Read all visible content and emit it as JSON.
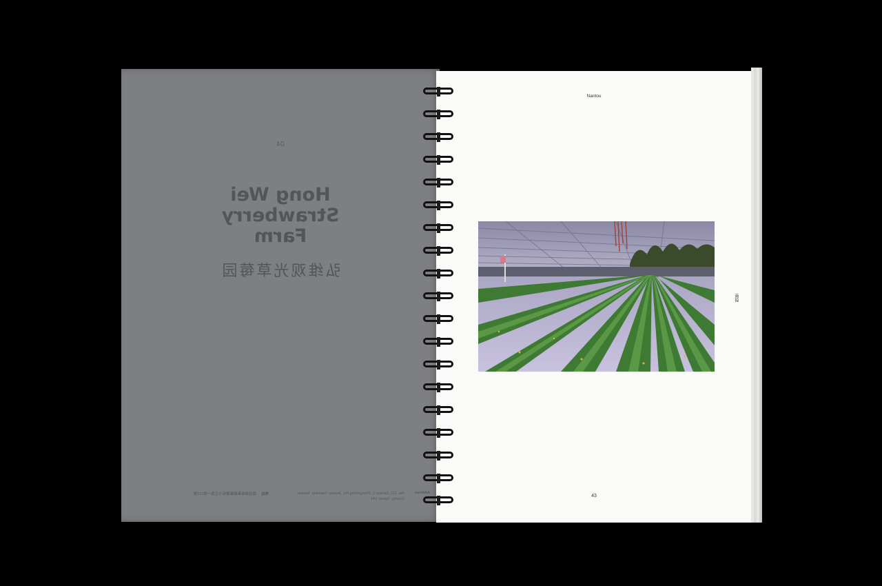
{
  "left_page": {
    "number": "04",
    "title_lines": [
      "Hong Wei",
      "Strawberry",
      "Farm"
    ],
    "chinese_title": "弘维观光草莓园",
    "footer": {
      "address_label": "Address",
      "address_en": "No. 112, Section 1, Zhongzheng Rd, Jieshou Township, Nantou County, Taiwan 544",
      "address_zh_label": "地址",
      "address_zh": "南投縣集集鎮集鹿街中正路一段112號"
    }
  },
  "right_page": {
    "header": "Nantou",
    "side_label": "南投",
    "page_number": "43"
  },
  "photo": {
    "subject": "strawberry-greenhouse-photo"
  },
  "colors": {
    "left_page": "#7d7f83",
    "left_text": "#53555a",
    "right_page": "#fafaf8",
    "background": "#000000"
  }
}
